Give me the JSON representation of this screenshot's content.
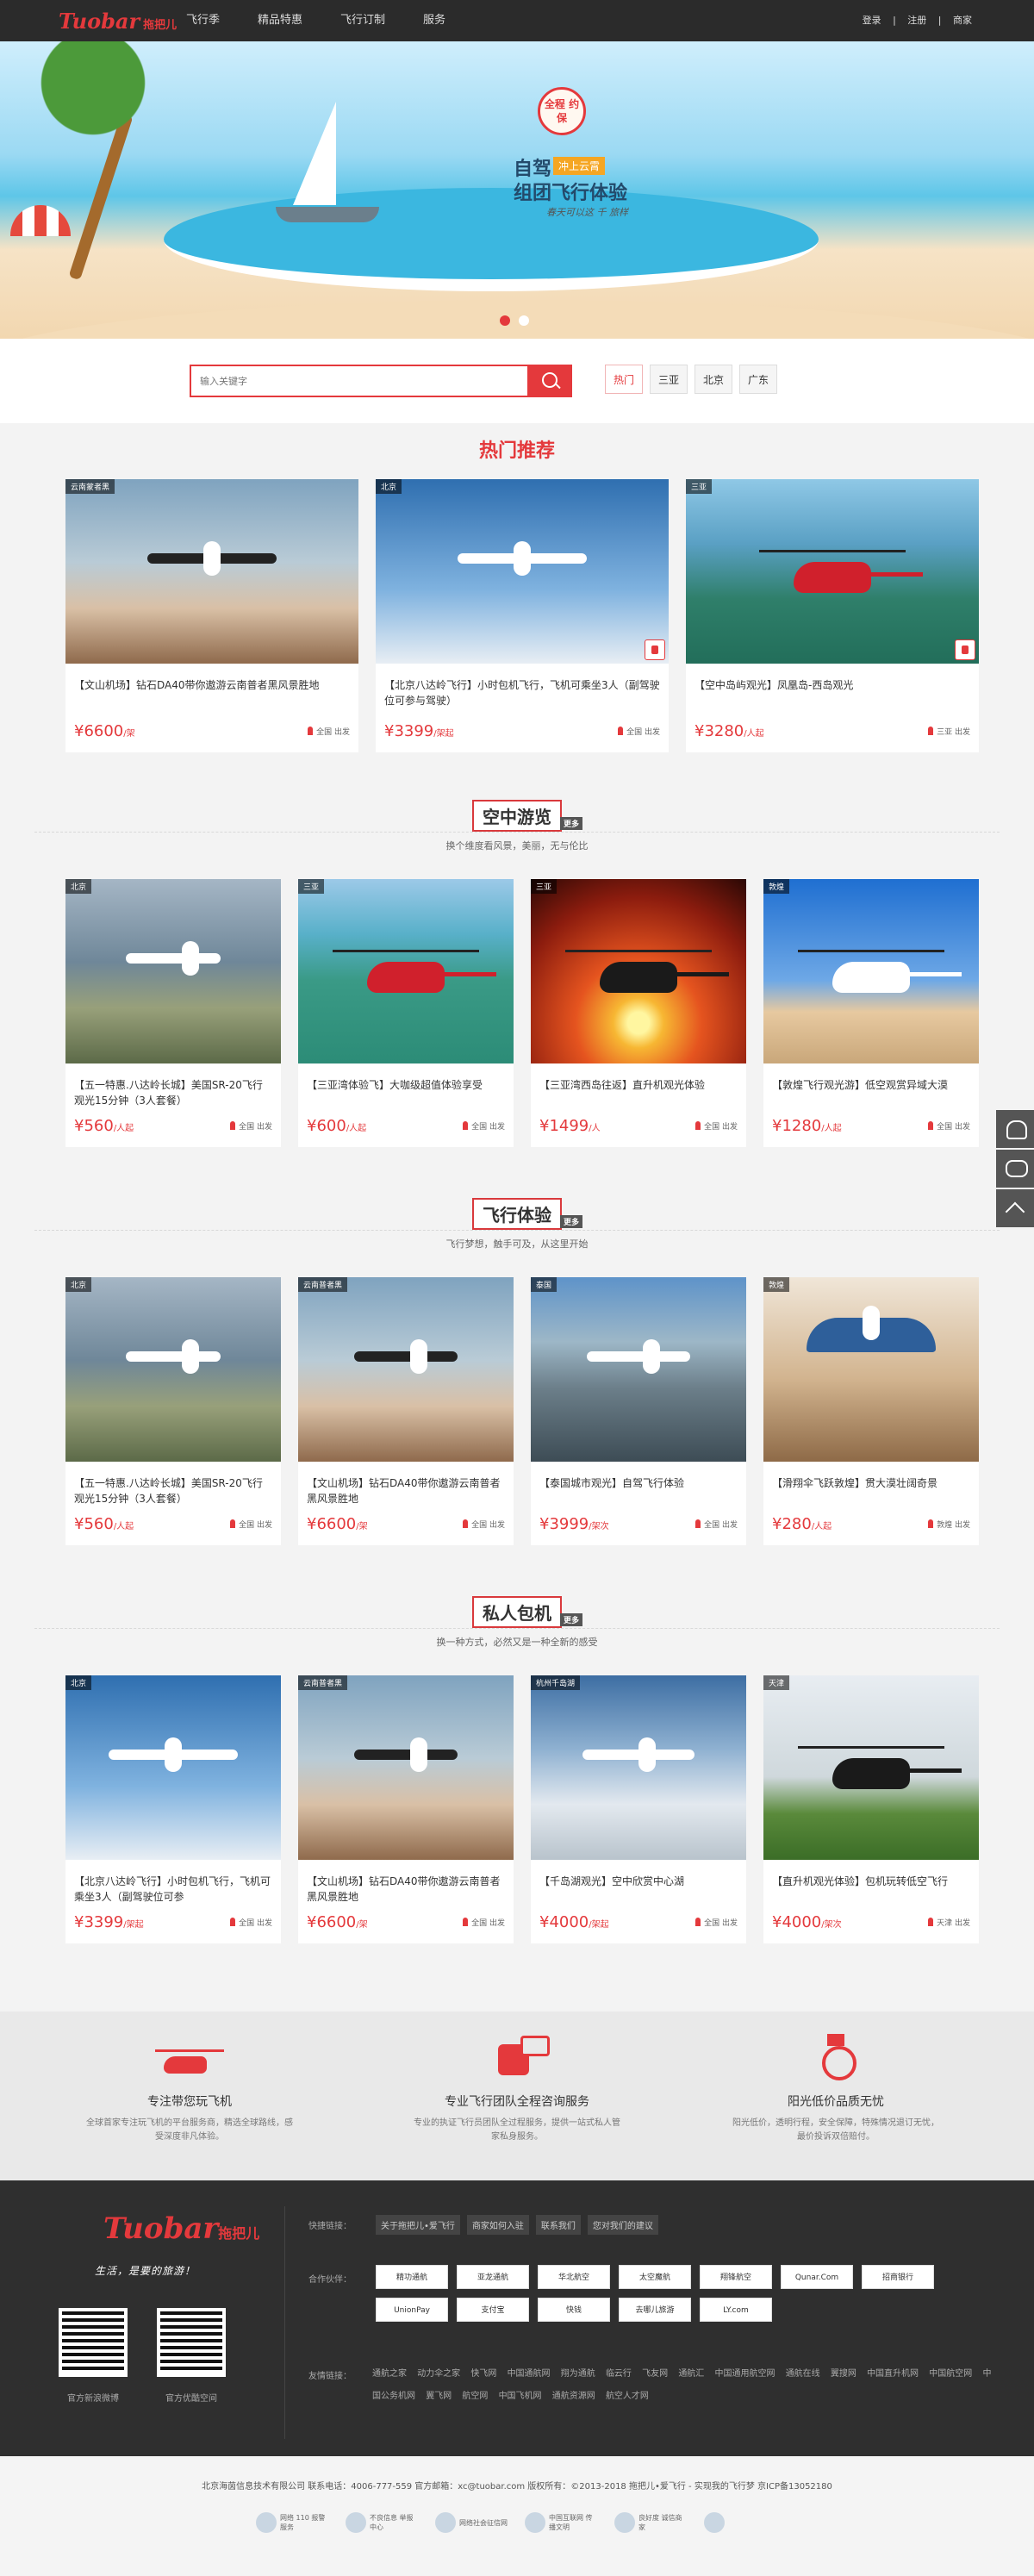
{
  "header": {
    "logo": "Tuobar",
    "logo_cn": "拖把儿",
    "nav": [
      "飞行季",
      "精品特惠",
      "飞行订制",
      "服务"
    ],
    "account": [
      "登录",
      "|",
      "注册",
      "|",
      "商家"
    ]
  },
  "banner": {
    "stamp": "全程 约保",
    "tag": "冲上云霄",
    "line1": "自驾",
    "line2": "组团飞行体验",
    "line3": "春天可以这 千 旅样"
  },
  "search": {
    "placeholder": "输入关键字",
    "tags": [
      "热门",
      "三亚",
      "北京",
      "广东"
    ]
  },
  "hot": {
    "title": "热门推荐",
    "cards": [
      {
        "loc": "云南蒙者黑",
        "title": "【文山机场】钻石DA40带你遨游云南普者黑风景胜地",
        "price": "¥6600",
        "unit": "/架",
        "dep": "全国 出发"
      },
      {
        "loc": "北京",
        "title": "【北京八达岭飞行】小时包机飞行，飞机可乘坐3人（副驾驶位可参与驾驶）",
        "price": "¥3399",
        "unit": "/架起",
        "dep": "全国 出发"
      },
      {
        "loc": "三亚",
        "title": "【空中岛屿观光】凤凰岛-西岛观光",
        "price": "¥3280",
        "unit": "/人起",
        "dep": "三亚 出发"
      }
    ]
  },
  "air": {
    "title": "空中游览",
    "more": "更多",
    "sub": "换个维度看风景，美丽，无与伦比",
    "cards": [
      {
        "loc": "北京",
        "title": "【五一特惠.八达岭长城】美国SR-20飞行观光15分钟（3人套餐）",
        "price": "¥560",
        "unit": "/人起",
        "dep": "全国 出发"
      },
      {
        "loc": "三亚",
        "title": "【三亚湾体验飞】大咖级超值体验享受",
        "price": "¥600",
        "unit": "/人起",
        "dep": "全国 出发"
      },
      {
        "loc": "三亚",
        "title": "【三亚湾西岛往返】直升机观光体验",
        "price": "¥1499",
        "unit": "/人",
        "dep": "全国 出发"
      },
      {
        "loc": "敦煌",
        "title": "【敦煌飞行观光游】低空观赏异域大漠",
        "price": "¥1280",
        "unit": "/人起",
        "dep": "全国 出发"
      }
    ]
  },
  "fly": {
    "title": "飞行体验",
    "more": "更多",
    "sub": "飞行梦想，触手可及，从这里开始",
    "cards": [
      {
        "loc": "北京",
        "title": "【五一特惠.八达岭长城】美国SR-20飞行观光15分钟（3人套餐）",
        "price": "¥560",
        "unit": "/人起",
        "dep": "全国 出发"
      },
      {
        "loc": "云南普者黑",
        "title": "【文山机场】钻石DA40带你遨游云南普者黑风景胜地",
        "price": "¥6600",
        "unit": "/架",
        "dep": "全国 出发"
      },
      {
        "loc": "泰国",
        "title": "【泰国城市观光】自驾飞行体验",
        "price": "¥3999",
        "unit": "/架次",
        "dep": "全国 出发"
      },
      {
        "loc": "敦煌",
        "title": "【滑翔伞飞跃敦煌】贯大漠壮阔奇景",
        "price": "¥280",
        "unit": "/人起",
        "dep": "敦煌 出发"
      }
    ]
  },
  "charter": {
    "title": "私人包机",
    "more": "更多",
    "sub": "换一种方式，必然又是一种全新的感受",
    "cards": [
      {
        "loc": "北京",
        "title": "【北京八达岭飞行】小时包机飞行，飞机可乘坐3人（副驾驶位可参",
        "price": "¥3399",
        "unit": "/架起",
        "dep": "全国 出发"
      },
      {
        "loc": "云南普者黑",
        "title": "【文山机场】钻石DA40带你遨游云南普者黑风景胜地",
        "price": "¥6600",
        "unit": "/架",
        "dep": "全国 出发"
      },
      {
        "loc": "杭州千岛湖",
        "title": "【千岛湖观光】空中欣赏中心湖",
        "price": "¥4000",
        "unit": "/架起",
        "dep": "全国 出发"
      },
      {
        "loc": "天津",
        "title": "【直升机观光体验】包机玩转低空飞行",
        "price": "¥4000",
        "unit": "/架次",
        "dep": "天津 出发"
      }
    ]
  },
  "features": [
    {
      "title": "专注带您玩飞机",
      "desc": "全球首家专注玩飞机的平台服务商，精选全球路线，感受深度非凡体验。"
    },
    {
      "title": "专业飞行团队全程咨询服务",
      "desc": "专业的执证飞行员团队全过程服务，提供一站式私人管家私身服务。"
    },
    {
      "title": "阳光低价品质无忧",
      "desc": "阳光低价，透明行程，安全保障，特殊情况退订无忧，最价投诉双倍赔付。"
    }
  ],
  "footer": {
    "logo": "Tuobar",
    "logo_cn": "拖把儿",
    "slogan": "生活，是要的旅游！",
    "qr_labels": [
      "官方新浪微博",
      "官方优酷空间"
    ],
    "quick_label": "快捷链接：",
    "quick": [
      "关于拖把儿•爱飞行",
      "商家如何入驻",
      "联系我们",
      "您对我们的建议"
    ],
    "partners_label": "合作伙伴：",
    "partners": [
      "精功通航",
      "亚龙通航",
      "华北航空",
      "太空魔航",
      "翔锋航空",
      "Qunar.Com",
      "招商银行",
      "UnionPay",
      "支付宝",
      "快钱",
      "去哪儿旅游",
      "LY.com"
    ],
    "links_label": "友情链接：",
    "links": [
      "通航之家",
      "动力伞之家",
      "快飞网",
      "中国通航网",
      "翔为通航",
      "中国通用航空网",
      "通航在线",
      "翼搜网",
      "中国直升机网",
      "中国航空网",
      "中国公务机网",
      "翼飞网",
      "航空网",
      "中国飞机网",
      "通航资源网",
      "航空人才网",
      "临云行",
      "飞友网",
      "通航汇"
    ]
  },
  "bottom": {
    "copyright": "北京海茵信息技术有限公司 联系电话：4006-777-559 官方邮箱：xc@tuobar.com 版权所有：©2013-2018 拖把儿•爱飞行 - 实现我的飞行梦 京ICP备13052180",
    "badges": [
      "网络 110 报警服务",
      "不良信息 举报中心",
      "网络社会征信网",
      "中国互联网 传播文明",
      "良好度 诚信商家",
      ""
    ]
  }
}
